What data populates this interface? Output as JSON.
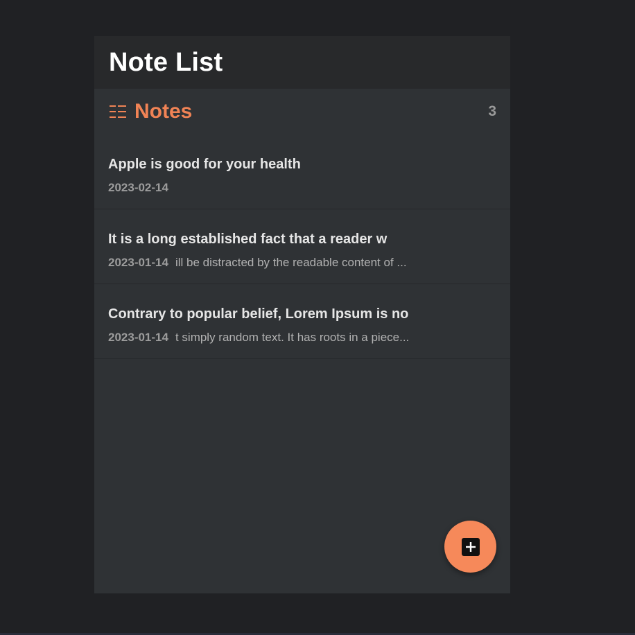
{
  "app": {
    "title": "Note List"
  },
  "notes_section": {
    "title": "Notes",
    "count": "3",
    "icon": "list-icon"
  },
  "notes": [
    {
      "title": "Apple is good for your health",
      "date": "2023-02-14",
      "preview": ""
    },
    {
      "title": "It is a long established fact that a reader w",
      "date": "2023-01-14",
      "preview": "ill be distracted by the readable content of ..."
    },
    {
      "title": "Contrary to popular belief, Lorem Ipsum is no",
      "date": "2023-01-14",
      "preview": "t simply random text. It has roots in a piece..."
    }
  ],
  "fab": {
    "icon": "add-note-icon"
  },
  "colors": {
    "accent": "#f08355",
    "fab": "#f6895a",
    "background": "#202124",
    "panel": "#2f3235",
    "header": "#28292b"
  }
}
